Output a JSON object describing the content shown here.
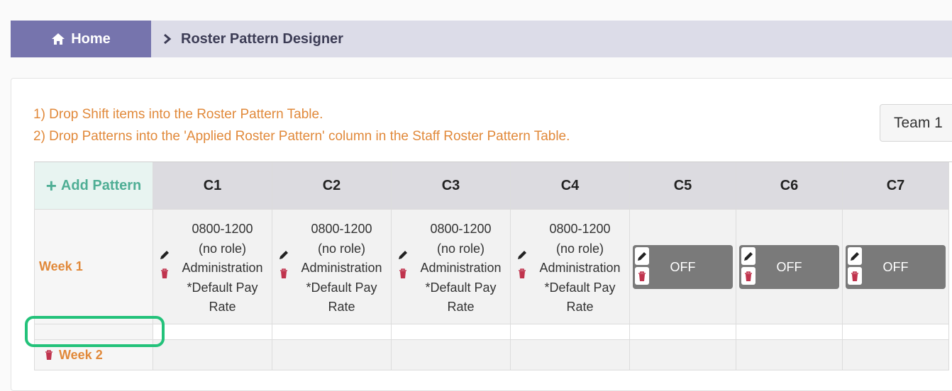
{
  "breadcrumb": {
    "home": "Home",
    "current": "Roster Pattern Designer"
  },
  "instructions": [
    "1) Drop Shift items into the Roster Pattern Table.",
    "2) Drop Patterns into the 'Applied Roster Pattern' column in the Staff Roster Pattern Table."
  ],
  "team_select": {
    "value": "Team 1"
  },
  "table": {
    "add_pattern": "Add Pattern",
    "columns": [
      "C1",
      "C2",
      "C3",
      "C4",
      "C5",
      "C6",
      "C7"
    ],
    "weeks": [
      {
        "label": "Week 1",
        "cells": [
          {
            "lines": [
              "0800-1200",
              "(no role)",
              "Administration",
              "*Default Pay",
              "Rate"
            ]
          },
          {
            "lines": [
              "0800-1200",
              "(no role)",
              "Administration",
              "*Default Pay",
              "Rate"
            ]
          },
          {
            "lines": [
              "0800-1200",
              "(no role)",
              "Administration",
              "*Default Pay",
              "Rate"
            ]
          },
          {
            "lines": [
              "0800-1200",
              "(no role)",
              "Administration",
              "*Default Pay",
              "Rate"
            ]
          },
          {
            "off": "OFF"
          },
          {
            "off": "OFF"
          },
          {
            "off": "OFF"
          }
        ]
      },
      {
        "label": "Week 2"
      }
    ]
  },
  "colors": {
    "home_bg": "#7674ad",
    "breadcrumb_bg": "#dcdce8",
    "instruction_text": "#e1893a",
    "add_pattern": "#4fae95",
    "trash": "#c0334d",
    "off_bg": "#7a7a7a",
    "highlight": "#23c27a"
  }
}
